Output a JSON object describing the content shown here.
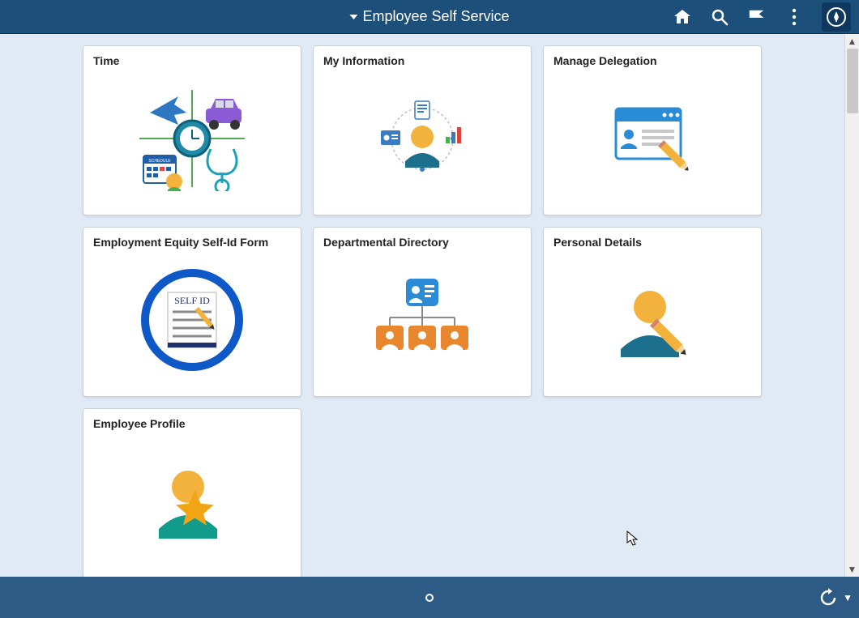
{
  "header": {
    "title": "Employee Self Service"
  },
  "tiles": [
    {
      "title": "Time"
    },
    {
      "title": "My Information"
    },
    {
      "title": "Manage Delegation"
    },
    {
      "title": "Employment Equity Self-Id Form"
    },
    {
      "title": "Departmental Directory"
    },
    {
      "title": "Personal Details"
    },
    {
      "title": "Employee Profile"
    }
  ]
}
